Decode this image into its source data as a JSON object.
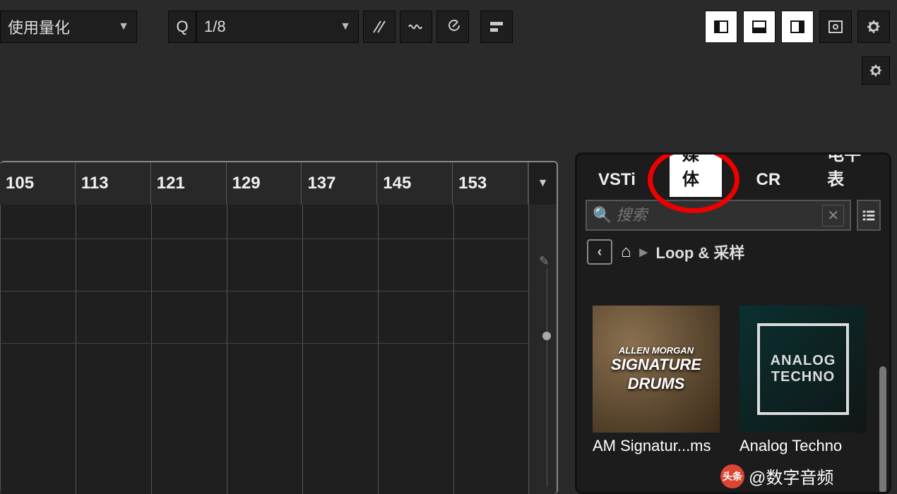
{
  "toolbar": {
    "quantize_label": "使用量化",
    "q_label": "Q",
    "resolution_label": "1/8"
  },
  "ruler": [
    "105",
    "113",
    "121",
    "129",
    "137",
    "145",
    "153"
  ],
  "tabs": {
    "vsti": "VSTi",
    "media": "媒体",
    "cr": "CR",
    "meter": "电平表"
  },
  "search": {
    "placeholder": "搜索"
  },
  "breadcrumb": {
    "path": "Loop & 采样"
  },
  "thumbs": [
    {
      "title_line1": "ALLEN MORGAN",
      "title_line2": "SIGNATURE",
      "title_line3": "DRUMS",
      "label": "AM Signatur...ms"
    },
    {
      "title_line1": "ANALOG",
      "title_line2": "TECHNO",
      "label": "Analog Techno"
    }
  ],
  "watermark": {
    "badge": "头条",
    "text": "@数字音频"
  }
}
